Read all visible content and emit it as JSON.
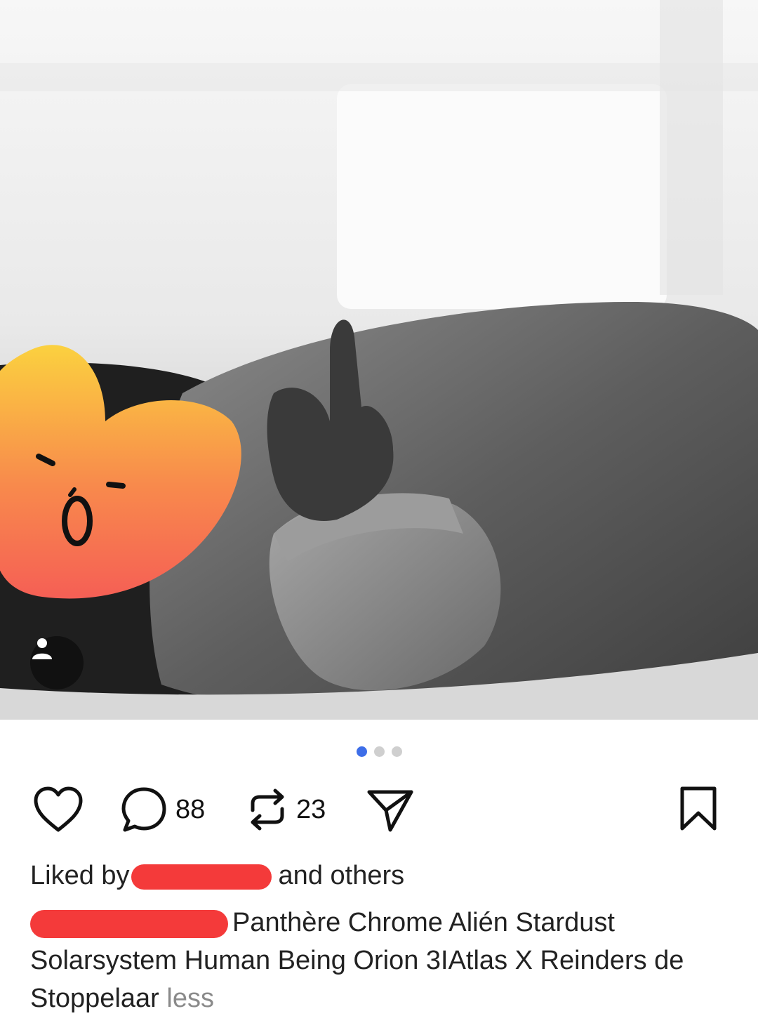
{
  "post": {
    "image_alt": "Black and white photo of a baby in a knit sweater raising a hand",
    "carousel": {
      "total": 3,
      "active": 1
    },
    "user_tag_icon": "person-icon"
  },
  "actions": {
    "like_icon": "heart-outline-icon",
    "comment_icon": "comment-bubble-icon",
    "comment_count": "88",
    "repost_icon": "repost-icon",
    "repost_count": "23",
    "share_icon": "send-paper-plane-icon",
    "bookmark_icon": "bookmark-outline-icon"
  },
  "likes": {
    "prefix": "Liked by",
    "suffix": "and others"
  },
  "caption": {
    "text": "Panthère Chrome Alién Stardust Solarsystem Human Being Orion 3IAtlas X Reinders de Stoppelaar",
    "less_label": "less"
  },
  "colors": {
    "carousel_active": "#3d6ee8",
    "redaction": "#f43a3a",
    "sticker_top": "#fbc63d",
    "sticker_bottom": "#f76653"
  }
}
